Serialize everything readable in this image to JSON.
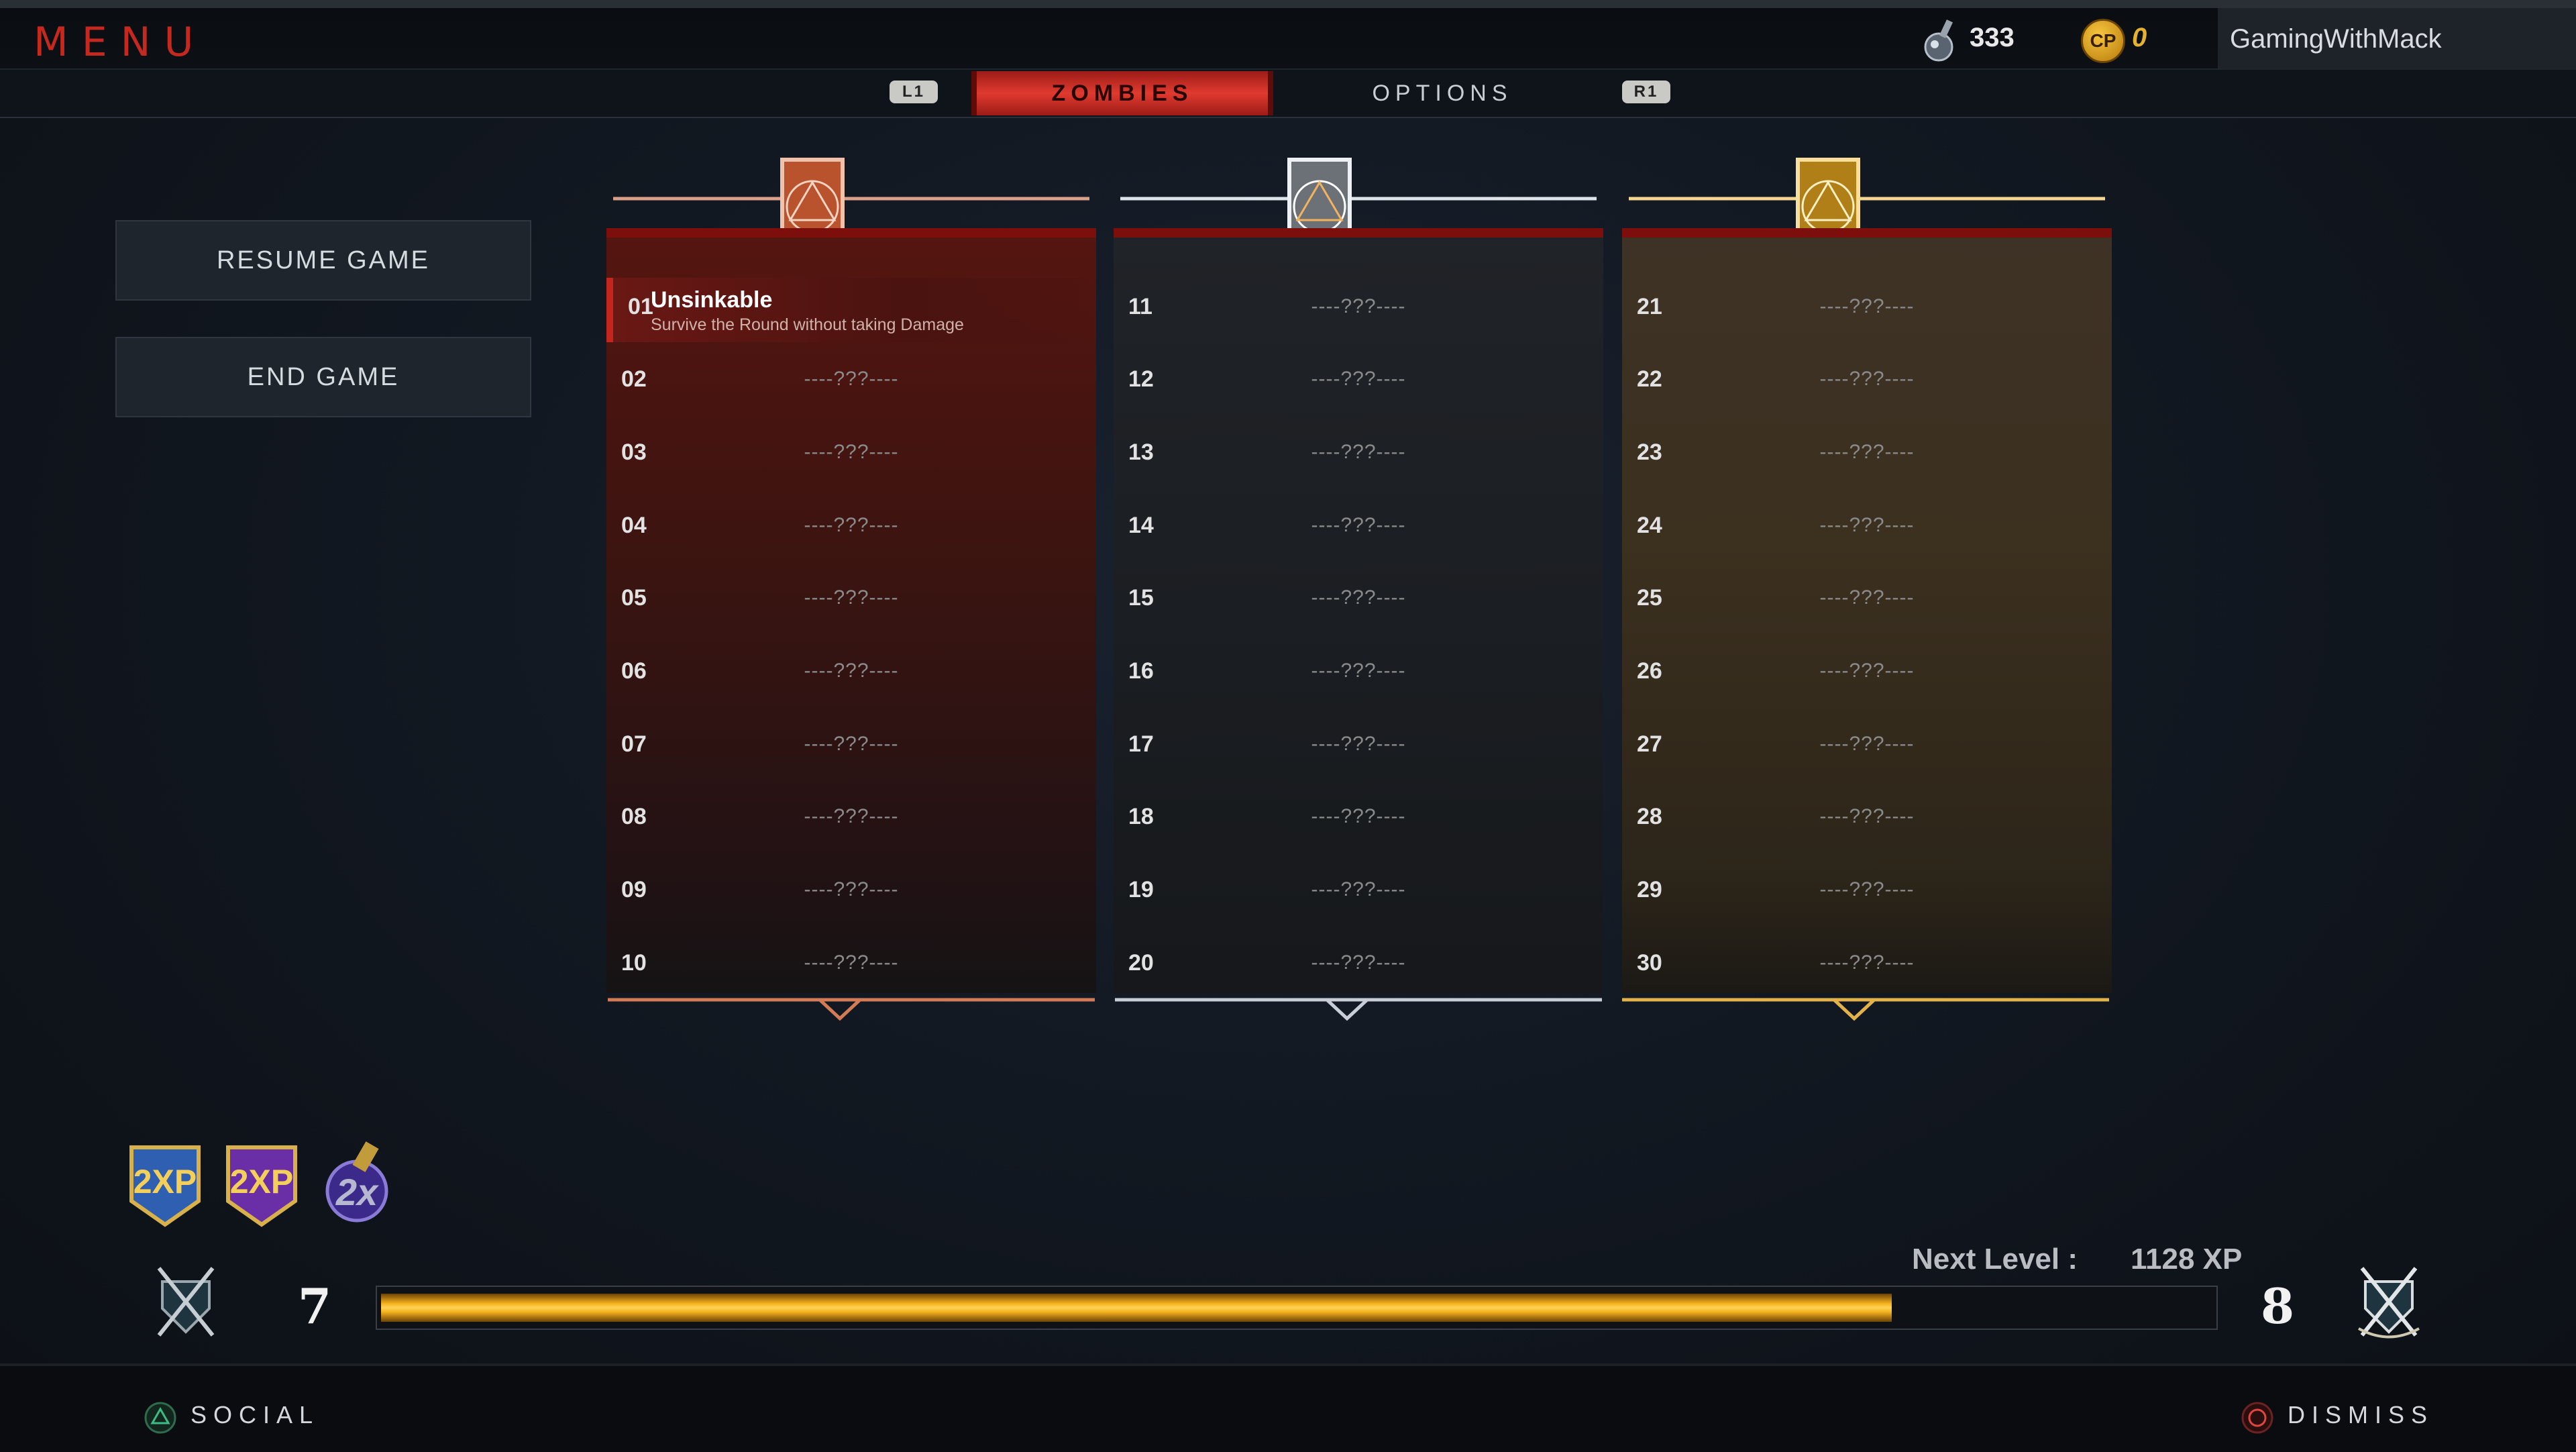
{
  "header": {
    "menu_title": "MENU",
    "liquid_label": "333",
    "cp_icon": "CP",
    "cp_value": "0",
    "username": "GamingWithMack"
  },
  "tabs": {
    "left_button": "L1",
    "right_button": "R1",
    "items": [
      {
        "label": "ZOMBIES",
        "active": true
      },
      {
        "label": "OPTIONS",
        "active": false
      }
    ]
  },
  "menu": {
    "resume": "RESUME GAME",
    "end": "END GAME"
  },
  "columns": [
    {
      "tier": "bronze",
      "rows": [
        {
          "num": "01",
          "title": "Unsinkable",
          "desc": "Survive the Round without taking Damage",
          "unlocked": true
        },
        {
          "num": "02",
          "text": "----???----"
        },
        {
          "num": "03",
          "text": "----???----"
        },
        {
          "num": "04",
          "text": "----???----"
        },
        {
          "num": "05",
          "text": "----???----"
        },
        {
          "num": "06",
          "text": "----???----"
        },
        {
          "num": "07",
          "text": "----???----"
        },
        {
          "num": "08",
          "text": "----???----"
        },
        {
          "num": "09",
          "text": "----???----"
        },
        {
          "num": "10",
          "text": "----???----"
        }
      ]
    },
    {
      "tier": "silver",
      "rows": [
        {
          "num": "11",
          "text": "----???----"
        },
        {
          "num": "12",
          "text": "----???----"
        },
        {
          "num": "13",
          "text": "----???----"
        },
        {
          "num": "14",
          "text": "----???----"
        },
        {
          "num": "15",
          "text": "----???----"
        },
        {
          "num": "16",
          "text": "----???----"
        },
        {
          "num": "17",
          "text": "----???----"
        },
        {
          "num": "18",
          "text": "----???----"
        },
        {
          "num": "19",
          "text": "----???----"
        },
        {
          "num": "20",
          "text": "----???----"
        }
      ]
    },
    {
      "tier": "gold",
      "rows": [
        {
          "num": "21",
          "text": "----???----"
        },
        {
          "num": "22",
          "text": "----???----"
        },
        {
          "num": "23",
          "text": "----???----"
        },
        {
          "num": "24",
          "text": "----???----"
        },
        {
          "num": "25",
          "text": "----???----"
        },
        {
          "num": "26",
          "text": "----???----"
        },
        {
          "num": "27",
          "text": "----???----"
        },
        {
          "num": "28",
          "text": "----???----"
        },
        {
          "num": "29",
          "text": "----???----"
        },
        {
          "num": "30",
          "text": "----???----"
        }
      ]
    }
  ],
  "boosts": [
    {
      "label": "2XP",
      "icon": "double-xp-icon",
      "color": "#2f5fb0"
    },
    {
      "label": "2XP",
      "icon": "double-weapon-xp-icon",
      "color": "#6a2fa6"
    },
    {
      "label": "2x",
      "icon": "double-gobblegum-icon",
      "color": "#3b2a8a"
    }
  ],
  "progress": {
    "current_level": "7",
    "next_level": "8",
    "next_label": "Next Level :",
    "next_xp": "1128 XP",
    "fill_fraction": 0.825
  },
  "footer": {
    "social": "SOCIAL",
    "dismiss": "DISMISS"
  },
  "colors": {
    "accent_red": "#c4281f",
    "bronze": "#d27b54",
    "silver": "#c9ced6",
    "gold": "#e3b34a",
    "xp_bar": "#f6b11d"
  }
}
